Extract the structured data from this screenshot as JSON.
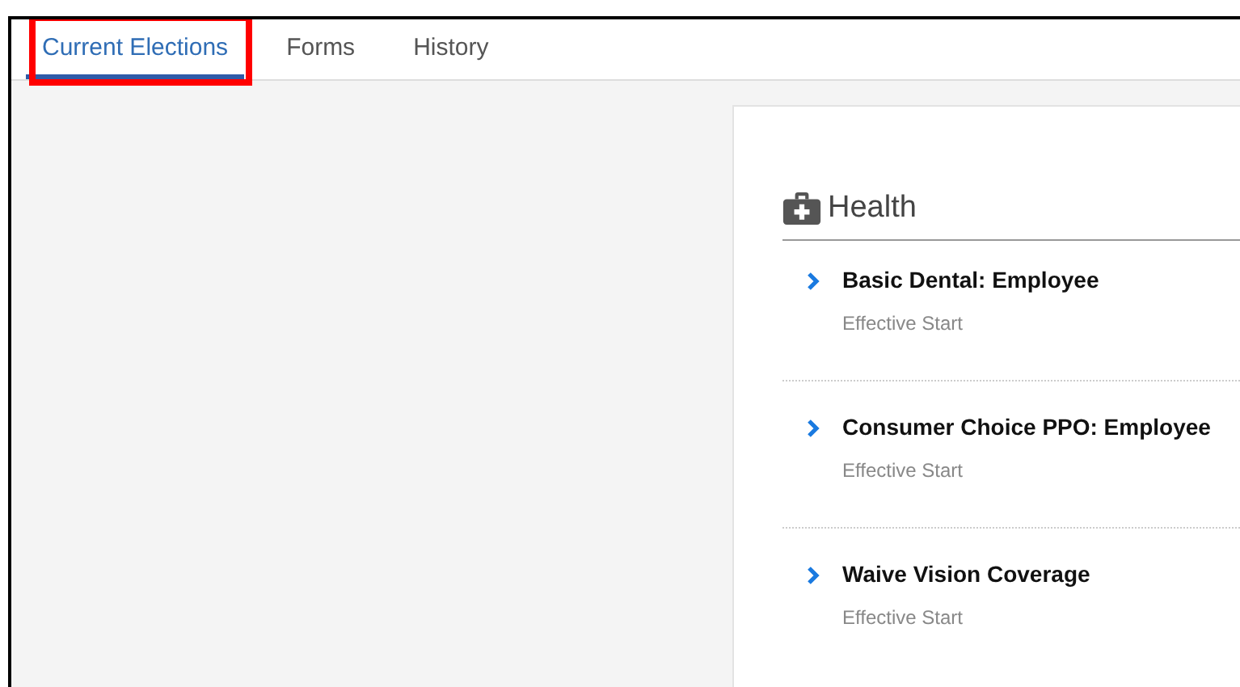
{
  "tabs": [
    {
      "label": "Current Elections",
      "selected": true,
      "highlighted": true
    },
    {
      "label": "Forms",
      "selected": false,
      "highlighted": false
    },
    {
      "label": "History",
      "selected": false,
      "highlighted": false
    }
  ],
  "section": {
    "title": "Health",
    "items": [
      {
        "name": "Basic Dental: Employee",
        "detail": "Effective Start"
      },
      {
        "name": "Consumer Choice PPO: Employee",
        "detail": "Effective Start"
      },
      {
        "name": "Waive Vision Coverage",
        "detail": "Effective Start"
      }
    ]
  }
}
